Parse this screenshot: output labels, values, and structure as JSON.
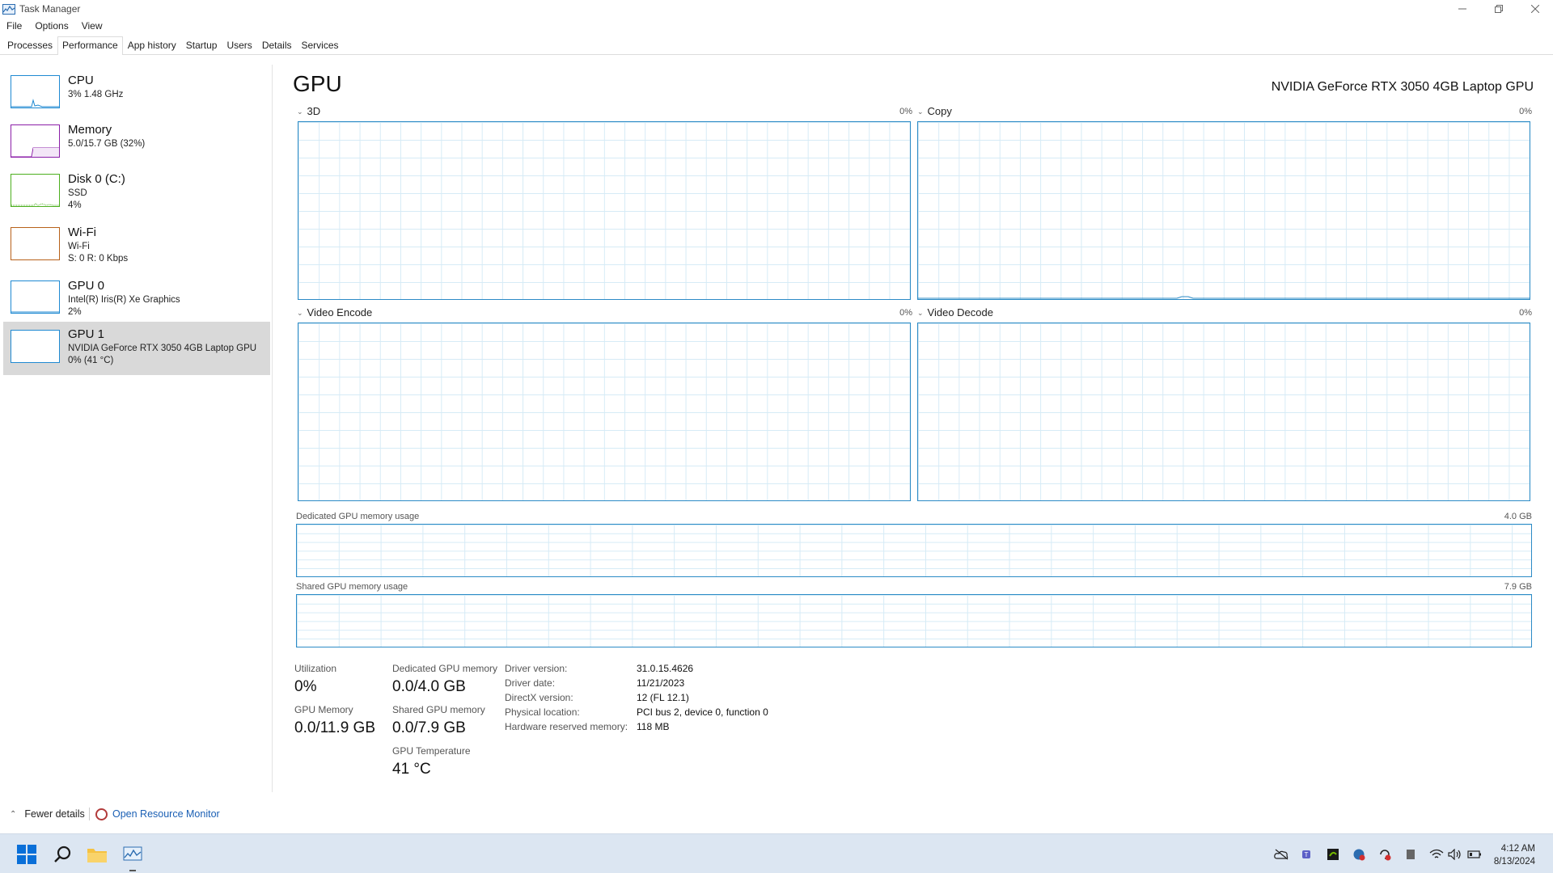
{
  "window": {
    "title": "Task Manager"
  },
  "menu": [
    "File",
    "Options",
    "View"
  ],
  "tabs": [
    "Processes",
    "Performance",
    "App history",
    "Startup",
    "Users",
    "Details",
    "Services"
  ],
  "sidebar": {
    "items": [
      {
        "title": "CPU",
        "lines": [
          "3%  1.48 GHz"
        ],
        "color": "#1f8ad2"
      },
      {
        "title": "Memory",
        "lines": [
          "5.0/15.7 GB (32%)"
        ],
        "color": "#8b1fa8"
      },
      {
        "title": "Disk 0 (C:)",
        "lines": [
          "SSD",
          "4%"
        ],
        "color": "#4caf1f"
      },
      {
        "title": "Wi-Fi",
        "lines": [
          "Wi-Fi",
          "S: 0  R: 0 Kbps"
        ],
        "color": "#b8611a"
      },
      {
        "title": "GPU 0",
        "lines": [
          "Intel(R) Iris(R) Xe Graphics",
          "2%"
        ],
        "color": "#1f8ad2"
      },
      {
        "title": "GPU 1",
        "lines": [
          "NVIDIA GeForce RTX 3050 4GB Laptop GPU",
          "0%  (41 °C)"
        ],
        "color": "#1f8ad2"
      }
    ]
  },
  "main": {
    "title": "GPU",
    "gpu_name": "NVIDIA GeForce RTX 3050 4GB Laptop GPU",
    "panels": [
      {
        "label": "3D",
        "pct": "0%"
      },
      {
        "label": "Copy",
        "pct": "0%"
      },
      {
        "label": "Video Encode",
        "pct": "0%"
      },
      {
        "label": "Video Decode",
        "pct": "0%"
      }
    ],
    "dedicated_mem": {
      "label": "Dedicated GPU memory usage",
      "max": "4.0 GB"
    },
    "shared_mem": {
      "label": "Shared GPU memory usage",
      "max": "7.9 GB"
    },
    "stats": {
      "utilization_label": "Utilization",
      "utilization": "0%",
      "gpu_memory_label": "GPU Memory",
      "gpu_memory": "0.0/11.9 GB",
      "dedicated_label": "Dedicated GPU memory",
      "dedicated": "0.0/4.0 GB",
      "shared_label": "Shared GPU memory",
      "shared": "0.0/7.9 GB",
      "temp_label": "GPU Temperature",
      "temp": "41 °C"
    },
    "info": [
      {
        "key": "Driver version:",
        "value": "31.0.15.4626"
      },
      {
        "key": "Driver date:",
        "value": "11/21/2023"
      },
      {
        "key": "DirectX version:",
        "value": "12 (FL 12.1)"
      },
      {
        "key": "Physical location:",
        "value": "PCI bus 2, device 0, function 0"
      },
      {
        "key": "Hardware reserved memory:",
        "value": "118 MB"
      }
    ]
  },
  "footer": {
    "fewer_details": "Fewer details",
    "resource_monitor": "Open Resource Monitor"
  },
  "taskbar": {
    "time": "4:12 AM",
    "date": "8/13/2024"
  },
  "colors": {
    "graph_border": "#2c8bc6",
    "link": "#1a5fb4"
  }
}
